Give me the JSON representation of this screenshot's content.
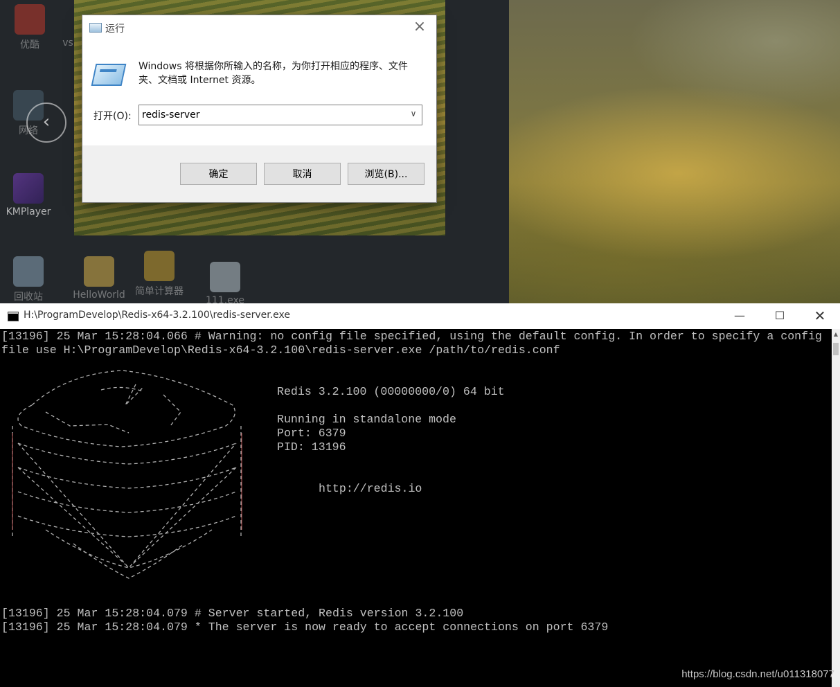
{
  "desktop": {
    "icons": [
      {
        "label": "优酷",
        "name": "desktop-icon-youku"
      },
      {
        "label": "vs",
        "name": "desktop-icon-vs"
      },
      {
        "label": "网络",
        "name": "desktop-icon-network"
      },
      {
        "label": "KMPlayer",
        "name": "desktop-icon-kmplayer"
      },
      {
        "label": "回收站",
        "name": "desktop-icon-recycle-bin"
      },
      {
        "label": "HelloWorld",
        "name": "desktop-icon-helloworld"
      },
      {
        "label": "简单计算器",
        "name": "desktop-icon-calculator"
      },
      {
        "label": "111.exe",
        "name": "desktop-icon-111"
      }
    ]
  },
  "run_dialog": {
    "title": "运行",
    "description": "Windows 将根据你所输入的名称，为你打开相应的程序、文件夹、文档或 Internet 资源。",
    "open_label": "打开(O):",
    "open_value": "redis-server",
    "ok_label": "确定",
    "cancel_label": "取消",
    "browse_label": "浏览(B)..."
  },
  "console": {
    "title": "H:\\ProgramDevelop\\Redis-x64-3.2.100\\redis-server.exe",
    "lines": {
      "warning_1": "[13196] 25 Mar 15:28:04.066 # Warning: no config file specified, using the default config. In order to specify a config",
      "warning_2": "file use H:\\ProgramDevelop\\Redis-x64-3.2.100\\redis-server.exe /path/to/redis.conf",
      "version": "Redis 3.2.100 (00000000/0) 64 bit",
      "mode": "Running in standalone mode",
      "port": "Port: 6379",
      "pid": "PID: 13196",
      "url": "http://redis.io",
      "started": "[13196] 25 Mar 15:28:04.079 # Server started, Redis version 3.2.100",
      "ready": "[13196] 25 Mar 15:28:04.079 * The server is now ready to accept connections on port 6379"
    }
  },
  "watermark": "https://blog.csdn.net/u011318077"
}
